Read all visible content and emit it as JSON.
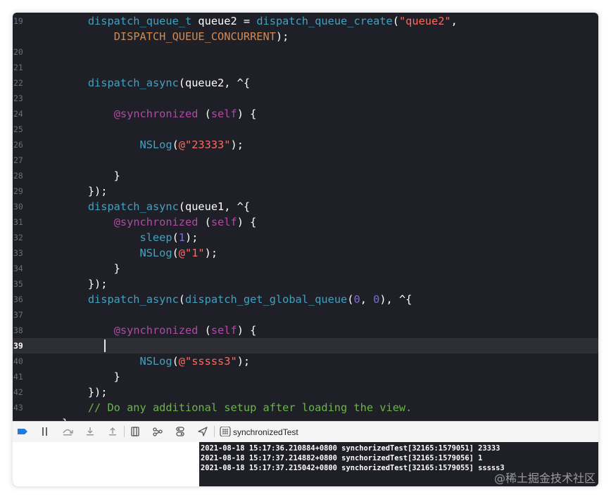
{
  "colors": {
    "editor_bg": "#1f2027",
    "plain": "#ffffff",
    "function": "#41a1c0",
    "string": "#fc6a5d",
    "keyword": "#b04aa5",
    "number": "#7d6cd1",
    "constant": "#d08a52",
    "comment": "#6bb449",
    "line_number": "#6b6e78",
    "debug_accent": "#1f7ae0"
  },
  "editor": {
    "lines": [
      {
        "num": "19",
        "segs": [
          {
            "t": "    "
          },
          {
            "t": "dispatch_queue_t",
            "c": "function"
          },
          {
            "t": " queue2 = "
          },
          {
            "t": "dispatch_queue_create",
            "c": "function"
          },
          {
            "t": "("
          },
          {
            "t": "\"queue2\"",
            "c": "string"
          },
          {
            "t": ","
          }
        ]
      },
      {
        "num": "",
        "segs": [
          {
            "t": "        "
          },
          {
            "t": "DISPATCH_QUEUE_CONCURRENT",
            "c": "constant"
          },
          {
            "t": ");"
          }
        ]
      },
      {
        "num": "20",
        "segs": []
      },
      {
        "num": "21",
        "segs": []
      },
      {
        "num": "22",
        "segs": [
          {
            "t": "    "
          },
          {
            "t": "dispatch_async",
            "c": "function"
          },
          {
            "t": "(queue2, ^{"
          }
        ]
      },
      {
        "num": "23",
        "segs": []
      },
      {
        "num": "24",
        "segs": [
          {
            "t": "        "
          },
          {
            "t": "@synchronized",
            "c": "keyword"
          },
          {
            "t": " ("
          },
          {
            "t": "self",
            "c": "keyword"
          },
          {
            "t": ") {"
          }
        ]
      },
      {
        "num": "25",
        "segs": []
      },
      {
        "num": "26",
        "segs": [
          {
            "t": "            "
          },
          {
            "t": "NSLog",
            "c": "function"
          },
          {
            "t": "("
          },
          {
            "t": "@\"23333\"",
            "c": "string"
          },
          {
            "t": ");"
          }
        ]
      },
      {
        "num": "27",
        "segs": []
      },
      {
        "num": "28",
        "segs": [
          {
            "t": "        }"
          }
        ]
      },
      {
        "num": "29",
        "segs": [
          {
            "t": "    });"
          }
        ]
      },
      {
        "num": "30",
        "segs": [
          {
            "t": "    "
          },
          {
            "t": "dispatch_async",
            "c": "function"
          },
          {
            "t": "(queue1, ^{"
          }
        ]
      },
      {
        "num": "31",
        "segs": [
          {
            "t": "        "
          },
          {
            "t": "@synchronized",
            "c": "keyword"
          },
          {
            "t": " ("
          },
          {
            "t": "self",
            "c": "keyword"
          },
          {
            "t": ") {"
          }
        ]
      },
      {
        "num": "32",
        "segs": [
          {
            "t": "            "
          },
          {
            "t": "sleep",
            "c": "function"
          },
          {
            "t": "("
          },
          {
            "t": "1",
            "c": "number"
          },
          {
            "t": ");"
          }
        ]
      },
      {
        "num": "33",
        "segs": [
          {
            "t": "            "
          },
          {
            "t": "NSLog",
            "c": "function"
          },
          {
            "t": "("
          },
          {
            "t": "@\"1\"",
            "c": "string"
          },
          {
            "t": ");"
          }
        ]
      },
      {
        "num": "34",
        "segs": [
          {
            "t": "        }"
          }
        ]
      },
      {
        "num": "35",
        "segs": [
          {
            "t": "    });"
          }
        ]
      },
      {
        "num": "36",
        "segs": [
          {
            "t": "    "
          },
          {
            "t": "dispatch_async",
            "c": "function"
          },
          {
            "t": "("
          },
          {
            "t": "dispatch_get_global_queue",
            "c": "function"
          },
          {
            "t": "("
          },
          {
            "t": "0",
            "c": "number"
          },
          {
            "t": ", "
          },
          {
            "t": "0",
            "c": "number"
          },
          {
            "t": "), ^{"
          }
        ]
      },
      {
        "num": "37",
        "segs": []
      },
      {
        "num": "38",
        "segs": [
          {
            "t": "        "
          },
          {
            "t": "@synchronized",
            "c": "keyword"
          },
          {
            "t": " ("
          },
          {
            "t": "self",
            "c": "keyword"
          },
          {
            "t": ") {"
          }
        ]
      },
      {
        "num": "39",
        "current": true,
        "segs": []
      },
      {
        "num": "40",
        "segs": [
          {
            "t": "            "
          },
          {
            "t": "NSLog",
            "c": "function"
          },
          {
            "t": "("
          },
          {
            "t": "@\"sssss3\"",
            "c": "string"
          },
          {
            "t": ");"
          }
        ]
      },
      {
        "num": "41",
        "segs": [
          {
            "t": "        }"
          }
        ]
      },
      {
        "num": "42",
        "segs": [
          {
            "t": "    });"
          }
        ]
      },
      {
        "num": "43",
        "segs": [
          {
            "t": "    "
          },
          {
            "t": "// Do any additional setup after loading the view.",
            "c": "comment"
          }
        ]
      },
      {
        "num": "",
        "segs": [
          {
            "t": "}"
          }
        ]
      }
    ]
  },
  "debug_bar": {
    "icons": [
      "breakpoints-toggle-icon",
      "pause-icon",
      "step-over-icon",
      "step-into-icon",
      "step-out-icon",
      "view-hierarchy-icon",
      "memory-graph-icon",
      "environment-overrides-icon",
      "simulate-location-icon",
      "app-target-icon"
    ],
    "target": "synchronizedTest"
  },
  "console": {
    "lines": [
      "2021-08-18 15:17:36.210884+0800 synchorizedTest[32165:1579051] 23333",
      "2021-08-18 15:17:37.214882+0800 synchorizedTest[32165:1579056] 1",
      "2021-08-18 15:17:37.215042+0800 synchorizedTest[32165:1579055] sssss3"
    ]
  },
  "watermark": "@稀土掘金技术社区"
}
